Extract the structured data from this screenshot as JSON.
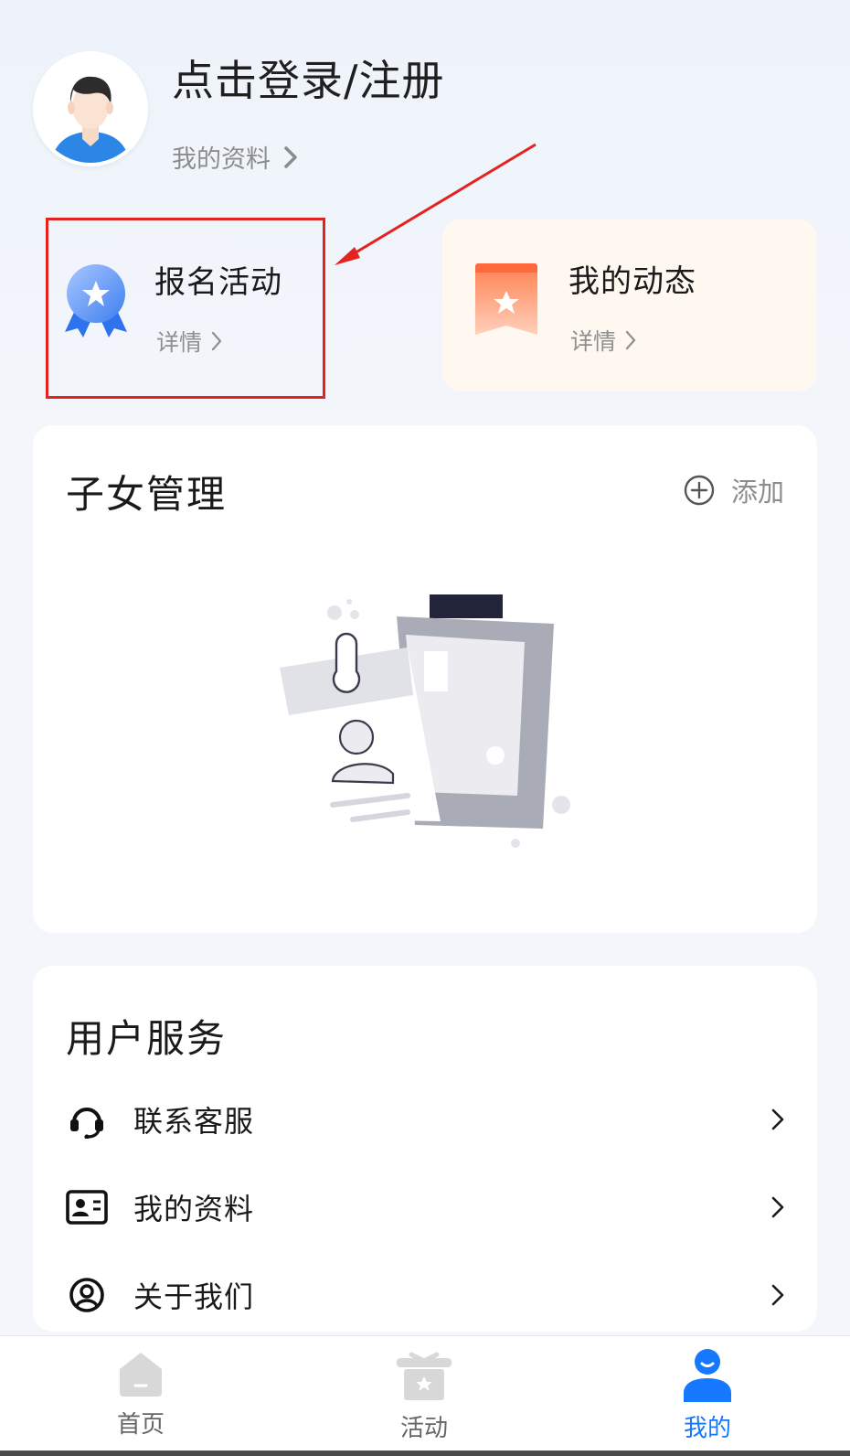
{
  "header": {
    "login_title": "点击登录/注册",
    "profile_link": "我的资料"
  },
  "quick_cards": [
    {
      "title": "报名活动",
      "sub": "详情"
    },
    {
      "title": "我的动态",
      "sub": "详情"
    }
  ],
  "children": {
    "title": "子女管理",
    "add_label": "添加"
  },
  "services": {
    "title": "用户服务",
    "items": [
      {
        "label": "联系客服",
        "icon": "headset-icon"
      },
      {
        "label": "我的资料",
        "icon": "id-card-icon"
      },
      {
        "label": "关于我们",
        "icon": "user-circle-icon"
      }
    ]
  },
  "tabbar": {
    "items": [
      {
        "label": "首页",
        "icon": "home-icon"
      },
      {
        "label": "活动",
        "icon": "gift-icon"
      },
      {
        "label": "我的",
        "icon": "person-icon"
      }
    ],
    "active_index": 2
  },
  "colors": {
    "accent": "#1677ff",
    "annotation": "#e3231f",
    "dyn_card_bg": "#fff8f1"
  }
}
